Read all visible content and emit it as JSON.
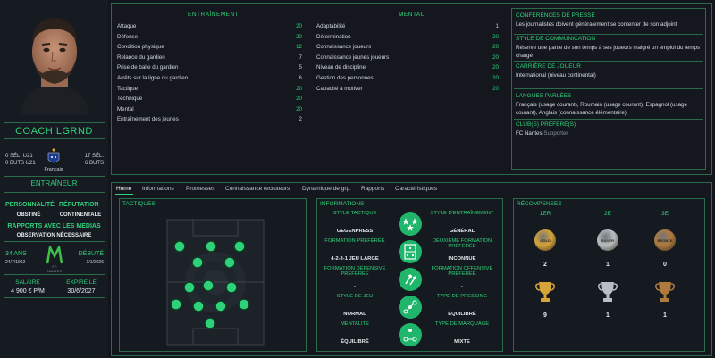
{
  "coach": {
    "name": "COACH LGRND",
    "sel_u21_left": "0 SÉL. U21",
    "buts_u21_left": "0 BUTS U21",
    "nationality": "Français",
    "sel_right": "17 SÉL.",
    "buts_right": "6 BUTS",
    "role": "ENTRAÎNEUR",
    "personality_label": "PERSONNALITÉ",
    "personality_value": "OBSTINÉ",
    "reputation_label": "RÉPUTATION",
    "reputation_value": "CONTINENTALE",
    "media_label": "RAPPORTS AVEC LES MEDIAS",
    "media_value": "OBSERVATION NÉCESSAIRE",
    "age_label": "34 ANS",
    "birthdate": "24/7/1992",
    "debut_label": "DÉBUTÉ",
    "debut_date": "1/1/2026",
    "salary_label": "SALAIRE",
    "salary_value": "4 900 € P/M",
    "expires_label": "EXPIRE LE",
    "expires_value": "30/6/2027",
    "club_badge_text": "FC NANTES"
  },
  "training": {
    "title": "ENTRAÎNEMENT",
    "rows": [
      {
        "label": "Attaque",
        "value": "20"
      },
      {
        "label": "Défense",
        "value": "20"
      },
      {
        "label": "Condition physique",
        "value": "12"
      },
      {
        "label": "Relance du gardien",
        "value": "7"
      },
      {
        "label": "Prise de balle du gardien",
        "value": "5"
      },
      {
        "label": "Arrêts sur la ligne du gardien",
        "value": "6"
      },
      {
        "label": "Tactique",
        "value": "20"
      },
      {
        "label": "Technique",
        "value": "20"
      },
      {
        "label": "Mental",
        "value": "20"
      },
      {
        "label": "Entraînement des jeunes",
        "value": "2"
      }
    ]
  },
  "mental": {
    "title": "MENTAL",
    "rows": [
      {
        "label": "Adaptabilité",
        "value": "1"
      },
      {
        "label": "Détermination",
        "value": "20"
      },
      {
        "label": "Connaissance joueurs",
        "value": "20"
      },
      {
        "label": "Connaissance jeunes joueurs",
        "value": "20"
      },
      {
        "label": "Niveau de discipline",
        "value": "20"
      },
      {
        "label": "Gestion des personnes",
        "value": "20"
      },
      {
        "label": "Capacité à motiver",
        "value": "20"
      }
    ]
  },
  "info": {
    "press_title": "CONFÉRENCES DE PRESSE",
    "press_text": "Les journalistes doivent généralement se contenter de son adjoint",
    "comm_title": "STYLE DE COMMUNICATION",
    "comm_text": "Réserve une partie de son temps à ses joueurs malgré un emploi du temps chargé",
    "career_title": "CARRIÈRE DE JOUEUR",
    "career_text": "International (niveau continental)",
    "lang_title": "LANGUES PARLÉES",
    "lang_text": "Français (usage courant), Roumain (usage courant), Espagnol (usage courant), Anglais (connaissance élémentaire)",
    "clubs_title": "CLUB(S) PRÉFÉRÉ(S)",
    "clubs_club": "FC Nantes",
    "clubs_role": "Supporter"
  },
  "tabs": [
    "Home",
    "Informations",
    "Promesses",
    "Connaissance recruteurs",
    "Dynamique de grp.",
    "Rapports",
    "Caractéristiques"
  ],
  "tactics": {
    "title": "TACTIQUES"
  },
  "informations": {
    "title": "INFORMATIONS",
    "rows": [
      {
        "left_label": "STYLE TACTIQUE",
        "left_value": "GEGENPRESS",
        "right_label": "STYLE D'ENTRAÎNEMENT",
        "right_value": "GÉNÉRAL",
        "icon": "stars-icon"
      },
      {
        "left_label": "FORMATION PRÉFÉRÉE",
        "left_value": "4-2-3-1 JEU LARGE",
        "right_label": "DEUXIÈME FORMATION PRÉFÉRÉE",
        "right_value": "INCONNUE",
        "icon": "pitch-formation-icon"
      },
      {
        "left_label": "FORMATION DÉFENSIVE PRÉFÉRÉE",
        "left_value": "-",
        "right_label": "FORMATION OFFENSIVE PRÉFÉRÉE",
        "right_value": "-",
        "icon": "arrows-icon"
      },
      {
        "left_label": "STYLE DE JEU",
        "left_value": "NORMAL",
        "right_label": "TYPE DE PRESSING",
        "right_value": "ÉQUILIBRÉ",
        "icon": "pressing-icon"
      },
      {
        "left_label": "MENTALITÉ",
        "left_value": "ÉQUILIBRÉ",
        "right_label": "TYPE DE MARQUAGE",
        "right_value": "MIXTE",
        "icon": "marking-icon"
      }
    ]
  },
  "rewards": {
    "title": "RÉCOMPENSES",
    "headers": [
      "1ER",
      "2E",
      "3E"
    ],
    "medals": [
      "GOLD",
      "SILVER",
      "BRONZE"
    ],
    "medal_counts": [
      "2",
      "1",
      "0"
    ],
    "trophy_counts": [
      "9",
      "1",
      "1"
    ]
  },
  "colors": {
    "accent": "#2fd17a",
    "border": "#2a6b4a",
    "gold": "#d6a437",
    "silver": "#b9bec4",
    "bronze": "#b07a3f"
  }
}
